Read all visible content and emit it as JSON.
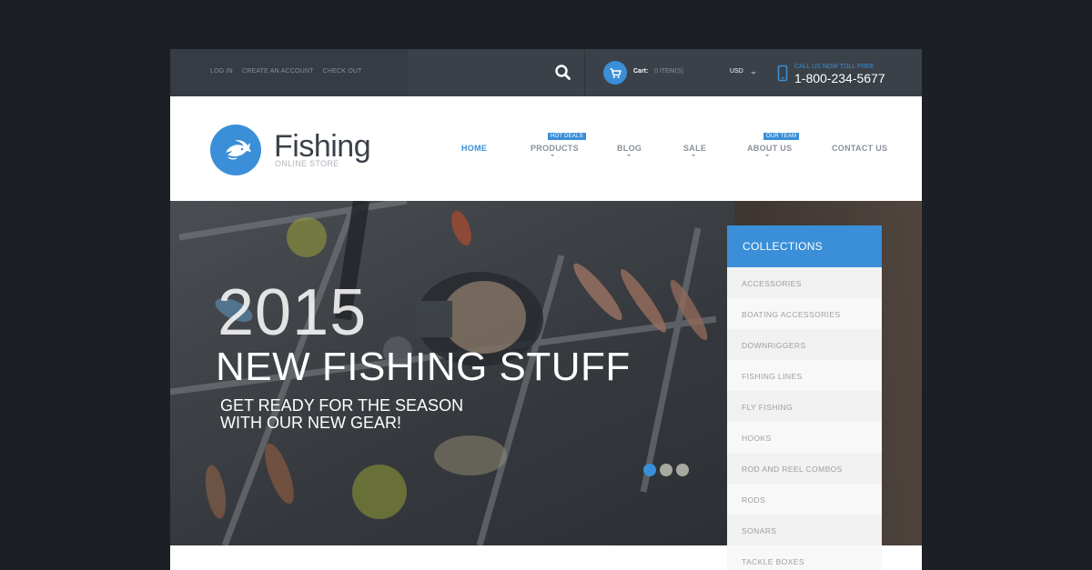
{
  "topbar": {
    "links": [
      "LOG IN",
      "CREATE AN ACCOUNT",
      "CHECK OUT"
    ],
    "cart_label": "Cart:",
    "cart_value": "0 ITEM(S)",
    "currency": "USD",
    "phone_caption": "CALL US NOW TOLL FREE",
    "phone_number": "1-800-234-5677"
  },
  "logo": {
    "title": "Fishing",
    "subtitle": "ONLINE STORE"
  },
  "nav": {
    "items": [
      "HOME",
      "PRODUCTS",
      "BLOG",
      "SALE",
      "ABOUT US",
      "CONTACT US"
    ],
    "badges": {
      "products": "HOT DEALS",
      "about": "OUR TEAM"
    },
    "active": "HOME"
  },
  "hero": {
    "year": "2015",
    "title": "NEW FISHING STUFF",
    "subtitle": "GET READY FOR THE SEASON\nWITH OUR NEW GEAR!",
    "slide_count": 3,
    "active_slide": 1
  },
  "collections": {
    "heading": "COLLECTIONS",
    "items": [
      "ACCESSORIES",
      "BOATING ACCESSORIES",
      "DOWNRIGGERS",
      "FISHING LINES",
      "FLY FISHING",
      "HOOKS",
      "ROD AND REEL COMBOS",
      "RODS",
      "SONARS",
      "TACKLE BOXES"
    ]
  },
  "colors": {
    "accent": "#3a8fd8",
    "topbar": "#3b4149",
    "background": "#1c1f23"
  },
  "icons": [
    "search-icon",
    "cart-icon",
    "phone-icon",
    "fish-logo-icon",
    "caret-down-icon"
  ]
}
